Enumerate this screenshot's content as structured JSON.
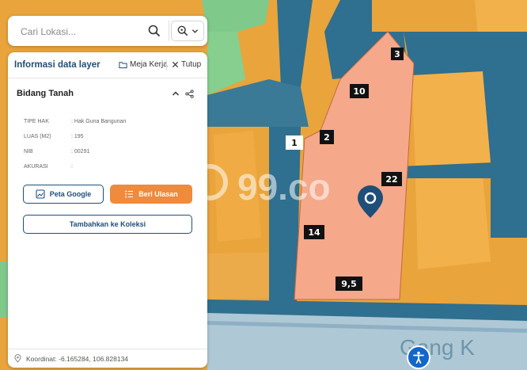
{
  "search": {
    "placeholder": "Cari Lokasi..."
  },
  "panel": {
    "title": "Informasi data layer",
    "workspace_label": "Meja Kerja",
    "close_label": "Tutup",
    "section_title": "Bidang Tanah",
    "fields": [
      {
        "key": "TIPE HAK",
        "value": ": Hak Guna Bangunan"
      },
      {
        "key": "LUAS (M2)",
        "value": ": 195"
      },
      {
        "key": "NIB",
        "value": ": 00291"
      },
      {
        "key": "AKURASI",
        "value": ":"
      }
    ],
    "google_button": "Peta Google",
    "review_button": "Beri Ulasan",
    "collection_button": "Tambahkan ke Koleksi",
    "coordinates": "Koordinat: -6.165284, 106.828134"
  },
  "map": {
    "labels": [
      "3",
      "10",
      "2",
      "1",
      "22",
      "14",
      "9,5"
    ],
    "watermark": "99.co",
    "street_label": "Gang K"
  },
  "colors": {
    "parcel_orange": "#f0a640",
    "road_blue": "#2f6f8f",
    "selected_parcel": "#f5a88a",
    "park_green": "#7fc98a",
    "accent_orange": "#f08a3c",
    "title_blue": "#1f4e79"
  },
  "icons": [
    "search-icon",
    "zoom-search-icon",
    "chevron-down-icon",
    "folder-icon",
    "close-icon",
    "chevron-up-icon",
    "share-icon",
    "map-icon",
    "list-icon",
    "location-pin-icon",
    "accessibility-icon"
  ]
}
